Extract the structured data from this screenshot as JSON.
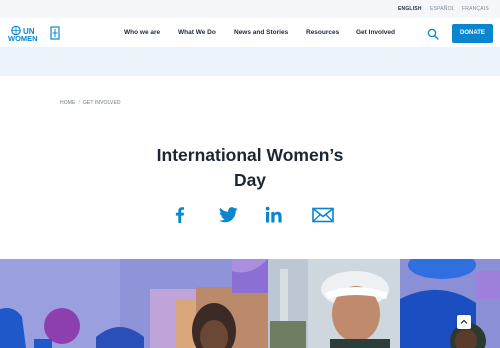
{
  "languages": [
    {
      "label": "ENGLISH",
      "active": true
    },
    {
      "label": "ESPAÑOL",
      "active": false
    },
    {
      "label": "FRANÇAIS",
      "active": false
    }
  ],
  "logo": {
    "line1": "UN",
    "line2": "WOMEN"
  },
  "nav": [
    "Who we are",
    "What We Do",
    "News and Stories",
    "Resources",
    "Get Involved"
  ],
  "donate_label": "DONATE",
  "breadcrumb": [
    "HOME",
    "GET INVOLVED"
  ],
  "page_title_line1": "International Women’s",
  "page_title_line2": "Day",
  "colors": {
    "accent": "#0a86cf",
    "text": "#1d2733",
    "hero_purple": "#8f94d8"
  }
}
